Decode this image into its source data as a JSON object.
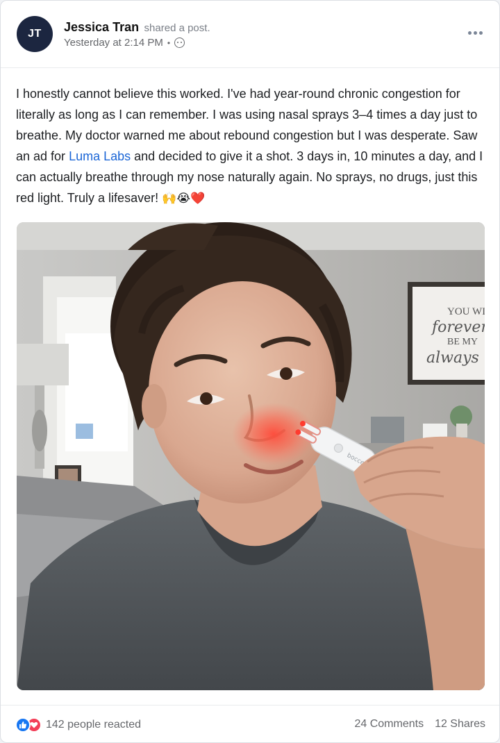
{
  "post": {
    "author": {
      "initials": "JT",
      "name": "Jessica Tran",
      "action": "shared a post."
    },
    "timestamp": "Yesterday at 2:14 PM",
    "separator": "•",
    "privacy_icon": "friends-icon",
    "text": {
      "before_link": "I honestly cannot believe this worked. I've had year-round chronic congestion for literally as long as I can remember. I was using nasal sprays 3–4 times a day just to breathe. My doctor warned me about rebound congestion but I was desperate. Saw an ad for ",
      "link": "Luma Labs",
      "after_link": " and decided to give it a shot. 3 days in, 10 minutes a day, and I can actually breathe through my nose naturally again. No sprays, no drugs, just this red light. Truly a lifesaver! ",
      "emojis": "🙌😭❤️"
    },
    "photo": {
      "sign_lines": [
        "YOU WILL",
        "forever",
        "BE MY",
        "always"
      ],
      "device_brand": "bocce"
    },
    "footer": {
      "reactions_label": "142 people reacted",
      "comments_label": "24 Comments",
      "shares_label": "12 Shares"
    }
  },
  "colors": {
    "avatar_bg": "#1c2640",
    "link": "#1a65d6",
    "like": "#1877f2",
    "love": "#f33e58"
  }
}
